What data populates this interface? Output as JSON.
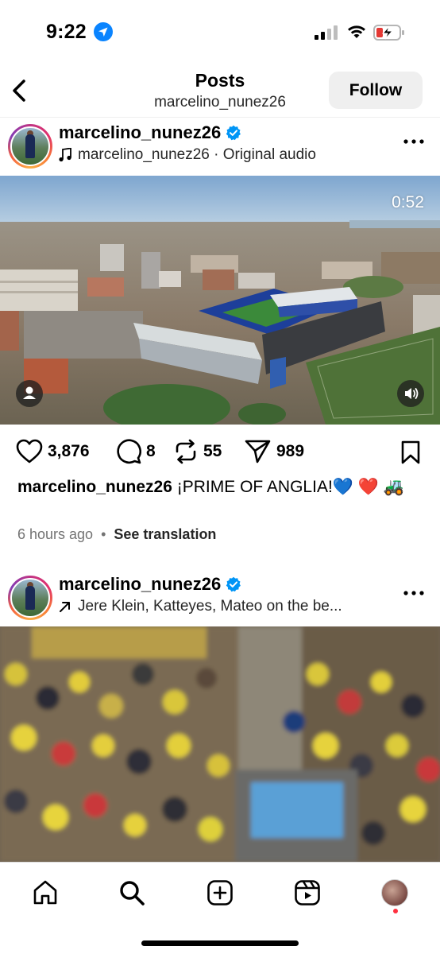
{
  "status_bar": {
    "time": "9:22"
  },
  "header": {
    "title": "Posts",
    "subtitle": "marcelino_nunez26",
    "follow_label": "Follow"
  },
  "posts": [
    {
      "username": "marcelino_nunez26",
      "subline_icon": "music-note-icon",
      "subline": "marcelino_nunez26 · Original audio",
      "media": {
        "type": "video",
        "duration": "0:52",
        "description_icons": [
          "person-tag-icon",
          "sound-on-icon"
        ]
      },
      "likes": "3,876",
      "comments": "8",
      "reposts": "55",
      "shares": "989",
      "caption_user": "marcelino_nunez26",
      "caption_text": "¡PRIME OF ANGLIA!💙 ❤️ 🚜",
      "time_ago": "6 hours ago",
      "translate_label": "See translation"
    },
    {
      "username": "marcelino_nunez26",
      "subline_icon": "tag-arrow-icon",
      "subline": "Jere Klein, Katteyes, Mateo on the be..."
    }
  ],
  "nav": [
    "home-icon",
    "search-icon",
    "create-icon",
    "reels-icon",
    "profile-avatar"
  ],
  "colors": {
    "accent_blue": "#0095f6",
    "verified": "#0095f6",
    "notification": "#ff3040"
  }
}
